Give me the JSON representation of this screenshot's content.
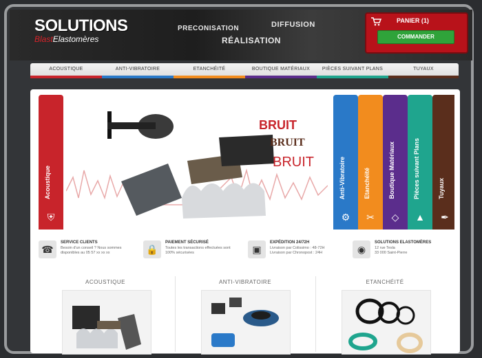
{
  "header": {
    "logo_main": "SOLUTIONS",
    "logo_sub_prefix": "Blast",
    "logo_sub_rest": "Elastomères",
    "nav": [
      "PRECONISATION",
      "DIFFUSION",
      "RÉALISATION"
    ],
    "cart": {
      "label": "PANIER (1)",
      "button": "COMMANDER",
      "icon": "cart-icon"
    }
  },
  "menu": [
    {
      "label": "ACOUSTIQUE",
      "color": "#c8242b"
    },
    {
      "label": "ANTI-VIBRATOIRE",
      "color": "#2a79c8"
    },
    {
      "label": "ETANCHÉITÉ",
      "color": "#f28c1e"
    },
    {
      "label": "BOUTIQUE MATÉRIAUX",
      "color": "#5b2d8c"
    },
    {
      "label": "PIÈCES SUIVANT PLANS",
      "color": "#1fa58e"
    },
    {
      "label": "TUYAUX",
      "color": "#5a2e1c"
    }
  ],
  "banner": {
    "left_tab": {
      "label": "Acoustique",
      "color": "#c8242b",
      "icon": "shield-icon"
    },
    "text_art": "BRUIT BRUIT BRUIT",
    "tabs": [
      {
        "label": "Anti-Vibratoire",
        "color": "#2a79c8",
        "icon": "gear-icon"
      },
      {
        "label": "Etanchéité",
        "color": "#f28c1e",
        "icon": "tools-icon"
      },
      {
        "label": "Boutique Matériaux",
        "color": "#5b2d8c",
        "icon": "box-icon"
      },
      {
        "label": "Pièces suivant Plans",
        "color": "#1fa58e",
        "icon": "plans-icon"
      },
      {
        "label": "Tuyaux",
        "color": "#5a2e1c",
        "icon": "pen-icon"
      }
    ]
  },
  "services": [
    {
      "icon": "phone-icon",
      "title": "SERVICE CLIENTS",
      "text": [
        "Besoin d'un conseil ? Nous sommes",
        "disponibles au 05 57 xx xx xx"
      ]
    },
    {
      "icon": "lock-icon",
      "title": "PAIEMENT SÉCURISÉ",
      "text": [
        "Toutes les transactions effectuées sont",
        "100% sécurisées"
      ]
    },
    {
      "icon": "box-icon",
      "title": "EXPÉDITION 24/72H",
      "text": [
        "Livraison par Colissimo : 48-72H",
        "Livraison par Chronopost : 24H"
      ]
    },
    {
      "icon": "globe-icon",
      "title": "SOLUTIONS ELASTOMÈRES",
      "text": [
        "12 rue Tesla",
        "33 000 Saint-Pierre"
      ]
    }
  ],
  "products": [
    {
      "title": "ACOUSTIQUE"
    },
    {
      "title": "ANTI-VIBRATOIRE"
    },
    {
      "title": "ETANCHÉITÉ"
    }
  ]
}
